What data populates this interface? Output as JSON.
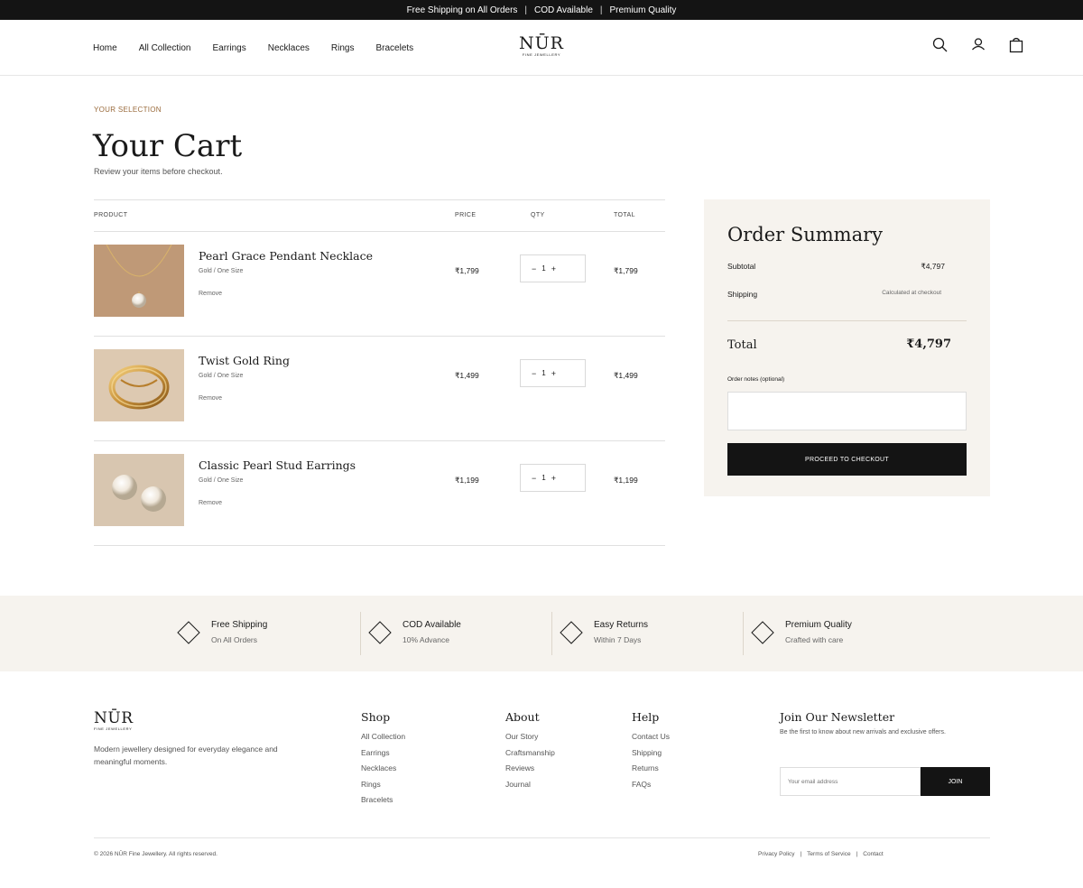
{
  "announcement": {
    "items": [
      "Free Shipping on All Orders",
      "COD Available",
      "Premium Quality"
    ],
    "separator": "|"
  },
  "header": {
    "nav": [
      "Home",
      "All Collection",
      "Earrings",
      "Necklaces",
      "Rings",
      "Bracelets"
    ],
    "logo": {
      "mark": "NŪR",
      "sub": "FINE JEWELLERY"
    },
    "icons": [
      "search-icon",
      "user-icon",
      "bag-icon"
    ]
  },
  "page": {
    "eyebrow": "YOUR SELECTION",
    "title": "Your Cart",
    "subtitle": "Review your items before checkout."
  },
  "cart": {
    "columns": {
      "product": "PRODUCT",
      "price": "PRICE",
      "qty": "QTY",
      "total": "TOTAL"
    },
    "remove_label": "Remove",
    "minus": "−",
    "plus": "+",
    "items": [
      {
        "name": "Pearl Grace Pendant Necklace",
        "variant": "Gold / One Size",
        "price": "₹1,799",
        "qty": "1",
        "total": "₹1,799"
      },
      {
        "name": "Twist Gold Ring",
        "variant": "Gold / One Size",
        "price": "₹1,499",
        "qty": "1",
        "total": "₹1,499"
      },
      {
        "name": "Classic Pearl Stud Earrings",
        "variant": "Gold / One Size",
        "price": "₹1,199",
        "qty": "1",
        "total": "₹1,199"
      }
    ]
  },
  "summary": {
    "title": "Order Summary",
    "subtotal_label": "Subtotal",
    "subtotal_value": "₹4,797",
    "shipping_label": "Shipping",
    "shipping_value": "Calculated at checkout",
    "total_label": "Total",
    "total_value": "₹4,797",
    "notes_label": "Order notes (optional)",
    "notes_value": "",
    "checkout_label": "PROCEED TO CHECKOUT"
  },
  "features": [
    {
      "title": "Free Shipping",
      "sub": "On All Orders"
    },
    {
      "title": "COD Available",
      "sub": "10% Advance"
    },
    {
      "title": "Easy Returns",
      "sub": "Within 7 Days"
    },
    {
      "title": "Premium Quality",
      "sub": "Crafted with care"
    }
  ],
  "footer": {
    "logo": {
      "mark": "NŪR",
      "sub": "FINE JEWELLERY"
    },
    "tagline": "Modern jewellery designed for everyday elegance and meaningful moments.",
    "columns": [
      {
        "title": "Shop",
        "links": [
          "All Collection",
          "Earrings",
          "Necklaces",
          "Rings",
          "Bracelets"
        ]
      },
      {
        "title": "About",
        "links": [
          "Our Story",
          "Craftsmanship",
          "Reviews",
          "Journal"
        ]
      },
      {
        "title": "Help",
        "links": [
          "Contact Us",
          "Shipping",
          "Returns",
          "FAQs"
        ]
      }
    ],
    "newsletter": {
      "title": "Join Our Newsletter",
      "text": "Be the first to know about new arrivals and exclusive offers.",
      "placeholder": "Your email address",
      "button": "JOIN"
    },
    "copyright": "© 2026 NŪR Fine Jewellery. All rights reserved.",
    "legal": [
      "Privacy Policy",
      "Terms of Service",
      "Contact"
    ]
  },
  "colors": {
    "accent": "#9a6b3c",
    "dark": "#141414",
    "cream": "#f6f3ee"
  }
}
